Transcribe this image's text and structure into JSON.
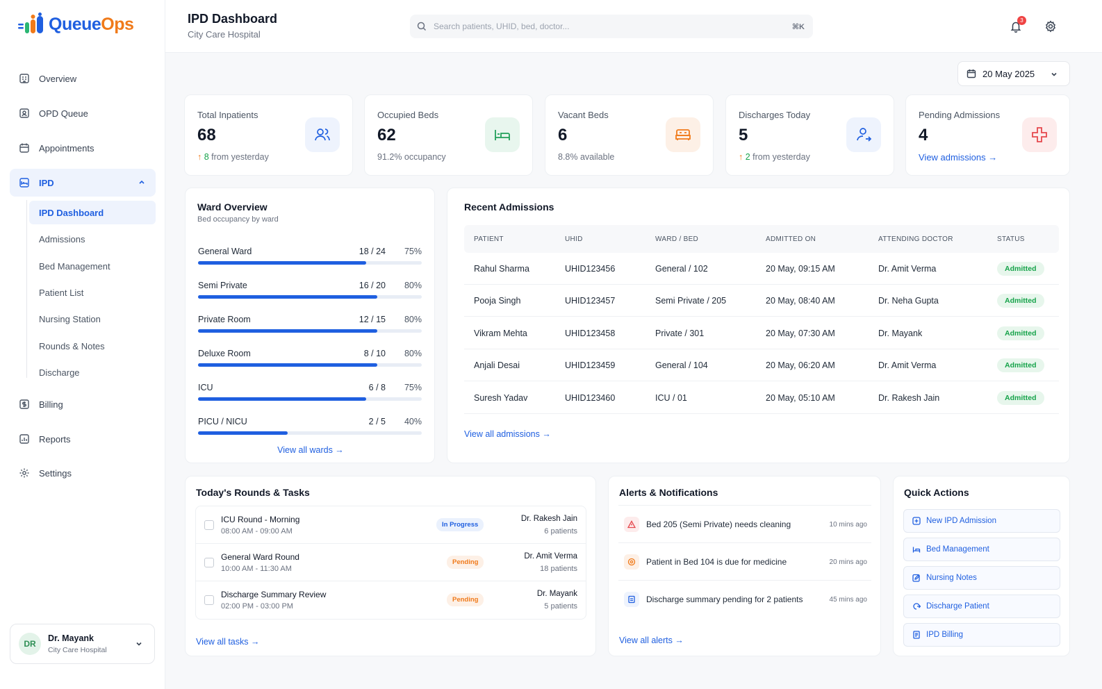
{
  "brand": {
    "part1": "Queue",
    "part2": "Ops",
    "primary": "#1f5fe0",
    "accent": "#f07a1a"
  },
  "sidebar": {
    "items": [
      {
        "label": "Overview",
        "icon": "building-icon"
      },
      {
        "label": "OPD Queue",
        "icon": "queue-icon"
      },
      {
        "label": "Appointments",
        "icon": "calendar-icon"
      },
      {
        "label": "IPD",
        "icon": "bed-icon"
      },
      {
        "label": "Billing",
        "icon": "dollar-icon"
      },
      {
        "label": "Reports",
        "icon": "report-icon"
      },
      {
        "label": "Settings",
        "icon": "gear-icon"
      }
    ],
    "ipd_sub": [
      "IPD Dashboard",
      "Admissions",
      "Bed Management",
      "Patient List",
      "Nursing Station",
      "Rounds & Notes",
      "Discharge"
    ],
    "user": {
      "initials": "DR",
      "name": "Dr. Mayank",
      "org": "City Care Hospital"
    }
  },
  "header": {
    "title": "IPD Dashboard",
    "subtitle": "City Care Hospital",
    "search_placeholder": "Search patients, UHID, bed, doctor...",
    "shortcut": "⌘K",
    "notif_count": "3"
  },
  "date": "20 May 2025",
  "stats": [
    {
      "label": "Total Inpatients",
      "value": "68",
      "trend": "↑",
      "delta": "8",
      "foot": " from yesterday"
    },
    {
      "label": "Occupied Beds",
      "value": "62",
      "foot": "91.2% occupancy"
    },
    {
      "label": "Vacant Beds",
      "value": "6",
      "foot": "8.8% available"
    },
    {
      "label": "Discharges Today",
      "value": "5",
      "trend": "↑",
      "delta": "2",
      "foot": " from yesterday"
    },
    {
      "label": "Pending Admissions",
      "value": "4",
      "link": "View admissions →"
    }
  ],
  "wards": {
    "title": "Ward Overview",
    "subtitle": "Bed occupancy by ward",
    "rows": [
      {
        "name": "General Ward",
        "count": "18 / 24",
        "pct": "75%",
        "frac": 0.75
      },
      {
        "name": "Semi Private",
        "count": "16 / 20",
        "pct": "80%",
        "frac": 0.8
      },
      {
        "name": "Private Room",
        "count": "12 / 15",
        "pct": "80%",
        "frac": 0.8
      },
      {
        "name": "Deluxe Room",
        "count": "8 / 10",
        "pct": "80%",
        "frac": 0.8
      },
      {
        "name": "ICU",
        "count": "6 / 8",
        "pct": "75%",
        "frac": 0.75
      },
      {
        "name": "PICU / NICU",
        "count": "2 / 5",
        "pct": "40%",
        "frac": 0.4
      }
    ],
    "link": "View all wards →"
  },
  "admissions": {
    "title": "Recent Admissions",
    "headers": [
      "PATIENT",
      "UHID",
      "WARD / BED",
      "ADMITTED ON",
      "ATTENDING DOCTOR",
      "STATUS"
    ],
    "rows": [
      [
        "Rahul Sharma",
        "UHID123456",
        "General / 102",
        "20 May, 09:15 AM",
        "Dr. Amit Verma",
        "Admitted"
      ],
      [
        "Pooja Singh",
        "UHID123457",
        "Semi Private / 205",
        "20 May, 08:40 AM",
        "Dr. Neha Gupta",
        "Admitted"
      ],
      [
        "Vikram Mehta",
        "UHID123458",
        "Private / 301",
        "20 May, 07:30 AM",
        "Dr. Mayank",
        "Admitted"
      ],
      [
        "Anjali Desai",
        "UHID123459",
        "General / 104",
        "20 May, 06:20 AM",
        "Dr. Amit Verma",
        "Admitted"
      ],
      [
        "Suresh Yadav",
        "UHID123460",
        "ICU / 01",
        "20 May, 05:10 AM",
        "Dr. Rakesh Jain",
        "Admitted"
      ]
    ],
    "link": "View all admissions →"
  },
  "tasks": {
    "title": "Today's Rounds & Tasks",
    "rows": [
      {
        "name": "ICU Round - Morning",
        "time": "08:00 AM - 09:00 AM",
        "status": "In Progress",
        "doctor": "Dr. Rakesh Jain",
        "patients": "6 patients"
      },
      {
        "name": "General Ward Round",
        "time": "10:00 AM - 11:30 AM",
        "status": "Pending",
        "doctor": "Dr. Amit Verma",
        "patients": "18 patients"
      },
      {
        "name": "Discharge Summary Review",
        "time": "02:00 PM - 03:00 PM",
        "status": "Pending",
        "doctor": "Dr. Mayank",
        "patients": "5 patients"
      }
    ],
    "link": "View all tasks →"
  },
  "alerts": {
    "title": "Alerts & Notifications",
    "rows": [
      {
        "text": "Bed 205 (Semi Private) needs cleaning",
        "time": "10 mins ago"
      },
      {
        "text": "Patient in Bed 104 is due for medicine",
        "time": "20 mins ago"
      },
      {
        "text": "Discharge summary pending for 2 patients",
        "time": "45 mins ago"
      }
    ],
    "link": "View all alerts →"
  },
  "quick": {
    "title": "Quick Actions",
    "items": [
      "New IPD Admission",
      "Bed Management",
      "Nursing Notes",
      "Discharge Patient",
      "IPD Billing"
    ]
  }
}
